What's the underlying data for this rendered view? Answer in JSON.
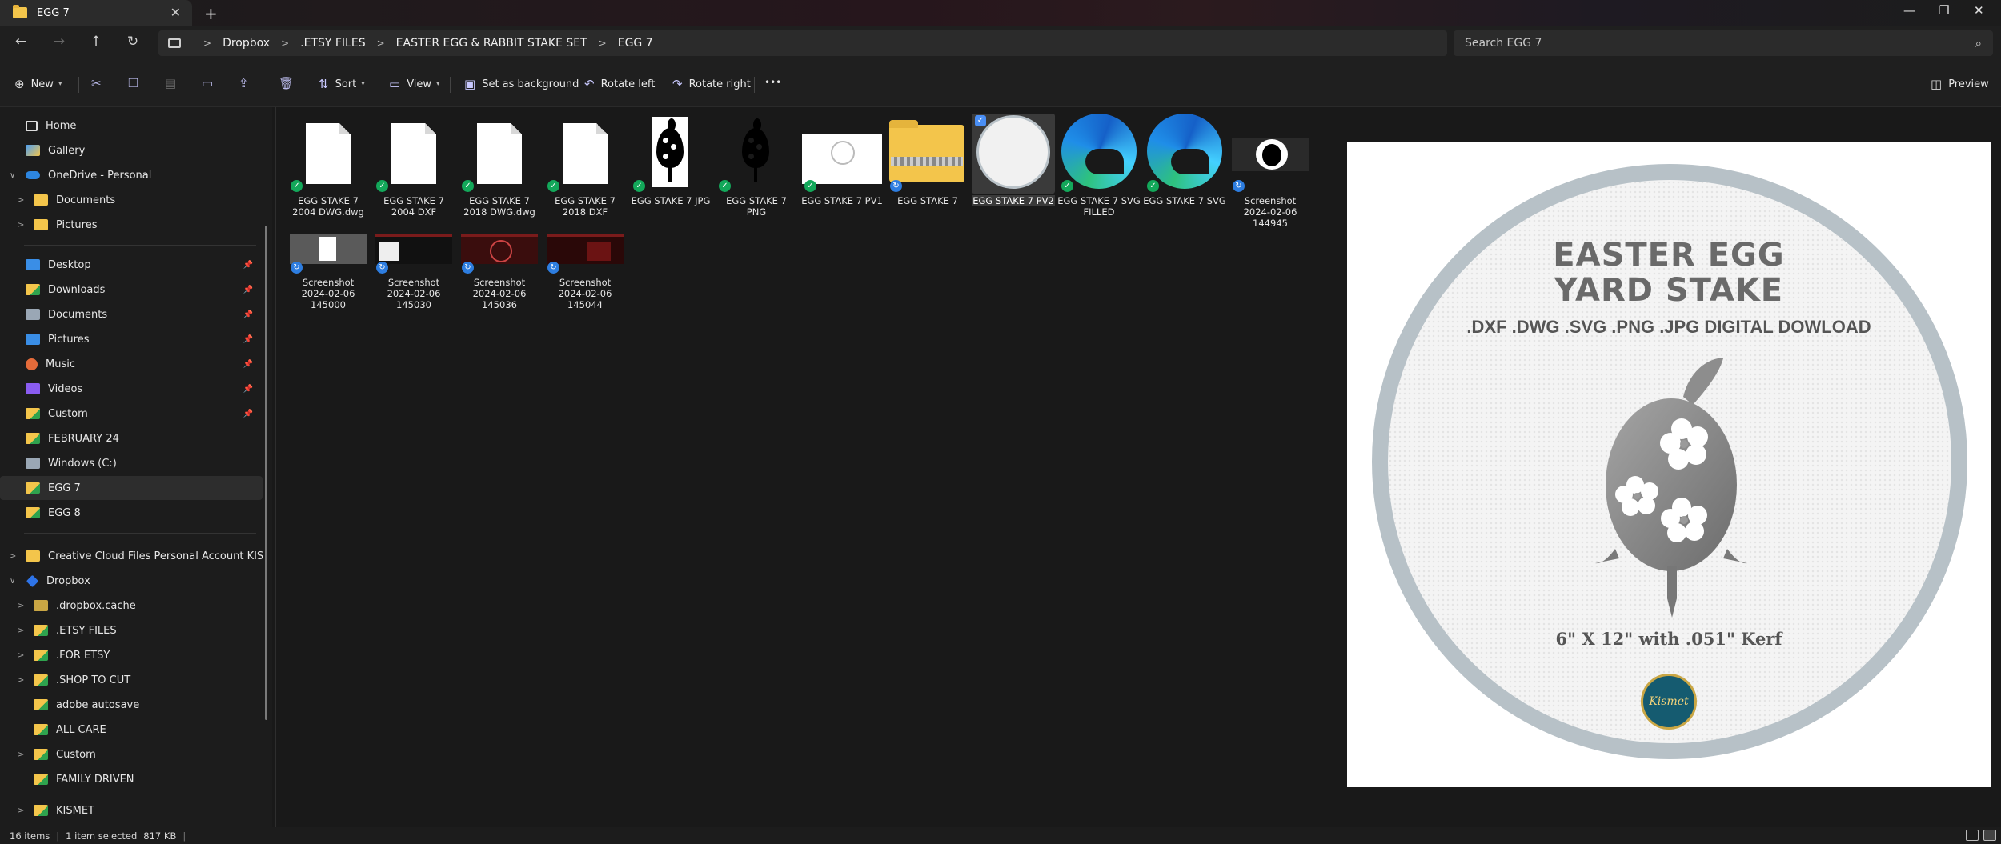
{
  "window": {
    "tab_title": "EGG 7",
    "new_tab": "+",
    "close": "✕",
    "minimize": "—",
    "maximize": "❐",
    "exit": "✕"
  },
  "nav": {
    "back": "←",
    "forward": "→",
    "up": "↑",
    "refresh": "↻",
    "breadcrumbs": [
      "Dropbox",
      ".ETSY FILES",
      "EASTER EGG & RABBIT STAKE SET",
      "EGG 7"
    ],
    "search_placeholder": "Search EGG 7"
  },
  "commands": {
    "new": "New",
    "sort": "Sort",
    "view": "View",
    "set_background": "Set as background",
    "rotate_left": "Rotate left",
    "rotate_right": "Rotate right",
    "more": "•••",
    "preview": "Preview"
  },
  "sidebar": {
    "home": "Home",
    "gallery": "Gallery",
    "onedrive": "OneDrive - Personal",
    "od_documents": "Documents",
    "od_pictures": "Pictures",
    "desktop": "Desktop",
    "downloads": "Downloads",
    "documents": "Documents",
    "pictures": "Pictures",
    "music": "Music",
    "videos": "Videos",
    "custom": "Custom",
    "february": "FEBRUARY 24",
    "windows_c": "Windows (C:)",
    "egg7": "EGG 7",
    "egg8": "EGG 8",
    "creative_cloud": "Creative Cloud Files Personal Account KISMETDESIGN",
    "dropbox": "Dropbox",
    "dropbox_cache": ".dropbox.cache",
    "etsy_files": ".ETSY FILES",
    "for_etsy": ".FOR ETSY",
    "shop_to_cut": ".SHOP TO CUT",
    "adobe_autosave": "adobe autosave",
    "all_care": "ALL CARE",
    "custom2": "Custom",
    "family_driven": "FAMILY DRIVEN",
    "kismet": "KISMET"
  },
  "files": {
    "f1": [
      "EGG STAKE 7",
      "2004 DWG.dwg"
    ],
    "f2": [
      "EGG STAKE 7",
      "2004 DXF"
    ],
    "f3": [
      "EGG STAKE 7",
      "2018 DWG.dwg"
    ],
    "f4": [
      "EGG STAKE 7",
      "2018 DXF"
    ],
    "f5": [
      "EGG STAKE 7 JPG"
    ],
    "f6": [
      "EGG STAKE 7",
      "PNG"
    ],
    "f7": [
      "EGG STAKE 7 PV1"
    ],
    "f8": [
      "EGG STAKE 7"
    ],
    "f9": [
      "EGG STAKE 7 PV2"
    ],
    "f10": [
      "EGG STAKE 7 SVG",
      "FILLED"
    ],
    "f11": [
      "EGG STAKE 7 SVG"
    ],
    "f12": [
      "Screenshot",
      "2024-02-06",
      "144945"
    ],
    "f13": [
      "Screenshot",
      "2024-02-06",
      "145000"
    ],
    "f14": [
      "Screenshot",
      "2024-02-06",
      "145030"
    ],
    "f15": [
      "Screenshot",
      "2024-02-06",
      "145036"
    ],
    "f16": [
      "Screenshot",
      "2024-02-06",
      "145044"
    ]
  },
  "preview_image": {
    "title1": "EASTER EGG",
    "title2": "YARD STAKE",
    "subtitle": ".DXF .DWG .SVG .PNG .JPG DIGITAL DOWLOAD",
    "kerf": "6\" X 12\" with .051\" Kerf",
    "logo": "Kismet"
  },
  "status": {
    "items": "16 items",
    "selected": "1 item selected",
    "size": "817 KB"
  },
  "colors": {
    "accent": "#4a8ff5",
    "ok_badge": "#13a85a",
    "sync_badge": "#2d7de0",
    "folder": "#f3c54b"
  }
}
